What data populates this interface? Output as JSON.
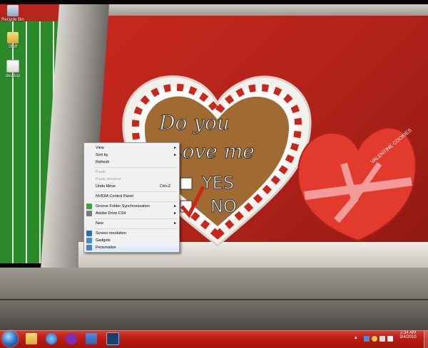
{
  "desktop": {
    "icons": [
      {
        "label": "Recycle Bin",
        "icon": "recycle-bin-icon"
      },
      {
        "label": "Stuff",
        "icon": "folder-icon"
      },
      {
        "label": "desktop",
        "icon": "file-icon"
      }
    ]
  },
  "wallpaper": {
    "cookie_text": [
      "Do you",
      "Love me",
      "YES",
      "NO"
    ],
    "box_text": "VALENTINE COOKIES"
  },
  "context_menu": {
    "items": [
      {
        "label": "View",
        "submenu": true
      },
      {
        "label": "Sort by",
        "submenu": true
      },
      {
        "label": "Refresh"
      },
      {
        "separator": true
      },
      {
        "label": "Paste",
        "disabled": true
      },
      {
        "label": "Paste shortcut",
        "disabled": true
      },
      {
        "label": "Undo Move",
        "shortcut": "Ctrl+Z"
      },
      {
        "separator": true
      },
      {
        "label": "NVIDIA Control Panel"
      },
      {
        "separator": true
      },
      {
        "label": "Groove Folder Synchronization",
        "submenu": true,
        "icon": "groove-icon"
      },
      {
        "label": "Adobe Drive CS4",
        "submenu": true,
        "icon": "adobe-drive-icon"
      },
      {
        "separator": true
      },
      {
        "label": "New",
        "submenu": true
      },
      {
        "separator": true
      },
      {
        "label": "Screen resolution",
        "icon": "screen-resolution-icon"
      },
      {
        "label": "Gadgets",
        "icon": "gadgets-icon"
      },
      {
        "label": "Personalize",
        "icon": "personalize-icon",
        "highlighted": true
      }
    ]
  },
  "taskbar": {
    "apps": [
      {
        "name": "windows-explorer",
        "icon": "folder-icon",
        "color": "#e8c55a"
      },
      {
        "name": "internet-explorer",
        "icon": "ie-icon",
        "color": "#3a8be0"
      },
      {
        "name": "yahoo-messenger",
        "icon": "messenger-icon",
        "color": "#7b2fb2"
      },
      {
        "name": "word",
        "icon": "word-icon",
        "color": "#2f5fb2"
      },
      {
        "name": "photoshop",
        "icon": "photoshop-icon",
        "color": "#1d3d6b"
      }
    ],
    "clock": {
      "time": "2:34 AM",
      "date": "3/4/2010"
    },
    "colors": {
      "accent": "#b81c13",
      "start_orb": "#2b6cc7"
    }
  }
}
